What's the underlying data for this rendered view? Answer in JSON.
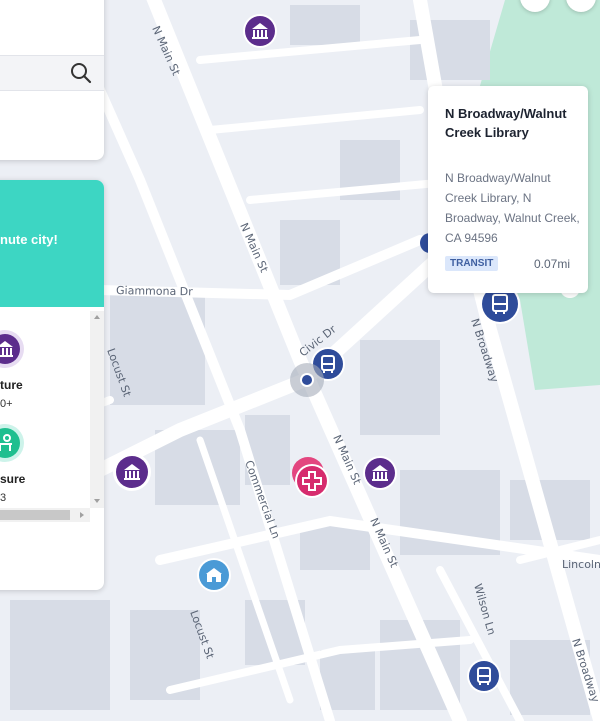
{
  "map": {
    "streets": [
      {
        "name": "N Main St"
      },
      {
        "name": "N Main St"
      },
      {
        "name": "N Main St"
      },
      {
        "name": "N Main St"
      },
      {
        "name": "Giammona Dr"
      },
      {
        "name": "Civic Dr"
      },
      {
        "name": "Locust St"
      },
      {
        "name": "Locust St"
      },
      {
        "name": "Commercial Ln"
      },
      {
        "name": "N Broadway"
      },
      {
        "name": "N Broadway"
      },
      {
        "name": "Wilson Ln"
      },
      {
        "name": "Lincoln"
      }
    ]
  },
  "score_panel": {
    "banner_text": "nute city!",
    "categories": [
      {
        "label": "ture",
        "count": "0+",
        "icon": "museum-icon"
      },
      {
        "label": "sure",
        "count": "3",
        "icon": "park-bench-icon"
      }
    ]
  },
  "popup": {
    "title": "N Broadway/Walnut Creek Library",
    "address": "N Broadway/Walnut Creek Library, N Broadway, Walnut Creek, CA 94596",
    "tag": "TRANSIT",
    "distance": "0.07mi"
  },
  "colors": {
    "map_background": "#eceff5",
    "road": "#ffffff",
    "building": "#d7dce6",
    "park": "#bfe9d8",
    "museum_marker": "#5c2d8c",
    "health_marker": "#d62c6e",
    "transit_marker": "#2f4c9a",
    "school_marker": "#4a9ad6",
    "banner": "#3dd6c3"
  }
}
